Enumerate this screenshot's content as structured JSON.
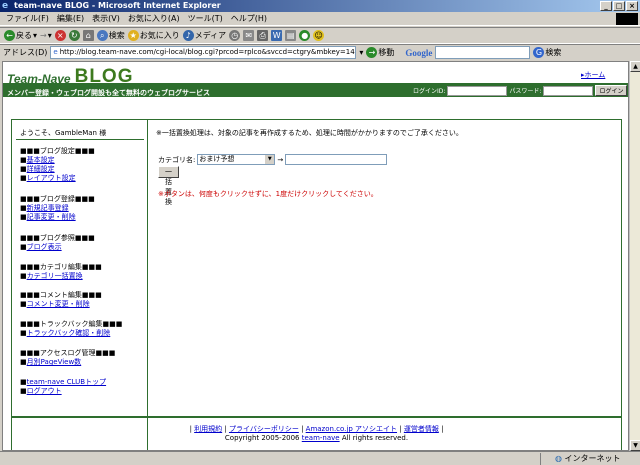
{
  "window": {
    "title": "team-nave BLOG - Microsoft Internet Explorer"
  },
  "menu": [
    "ファイル(F)",
    "編集(E)",
    "表示(V)",
    "お気に入り(A)",
    "ツール(T)",
    "ヘルプ(H)"
  ],
  "toolbar": {
    "back": "戻る",
    "search": "検索",
    "favorites": "お気に入り",
    "media": "メディア"
  },
  "address": {
    "label": "アドレス(D)",
    "url": "http://blog.team-nave.com/cgi-local/blog.cgi?prcod=rplco&svccd=ctgry&mbkey=146e6785",
    "go": "移動",
    "google_label": "Google",
    "google_search": "検索"
  },
  "header": {
    "logo_team": "Team-Nave",
    "logo_blog": "BLOG",
    "tagline": "メンバー登録・ウェブログ開設も全て無料のウェブログサービス",
    "home_link": "ホーム",
    "login_id_label": "ログインID:",
    "password_label": "パスワード:",
    "login_button": "ログイン"
  },
  "sidebar": {
    "welcome": "ようこそ、GambleMan 様",
    "sections": [
      {
        "head": "■■■ブログ設定■■■",
        "links": [
          "基本設定",
          "詳細設定",
          "レイアウト設定"
        ]
      },
      {
        "head": "■■■ブログ登録■■■",
        "links": [
          "新規記事登録",
          "記事変更・削除"
        ]
      },
      {
        "head": "■■■ブログ参照■■■",
        "links": [
          "ブログ表示"
        ]
      },
      {
        "head": "■■■カテゴリ編集■■■",
        "links": [
          "カテゴリ一括置換"
        ]
      },
      {
        "head": "■■■コメント編集■■■",
        "links": [
          "コメント変更・削除"
        ]
      },
      {
        "head": "■■■トラックバック編集■■■",
        "links": [
          "トラックバック確認・削除"
        ]
      },
      {
        "head": "■■■アクセスログ管理■■■",
        "links": [
          "月別PageView数"
        ]
      }
    ],
    "bottom_links": [
      "team-nave CLUBトップ",
      "ログアウト"
    ]
  },
  "main": {
    "notice": "※一括置換処理は、対象の記事を再作成するため、処理に時間がかかりますのでご了承ください。",
    "category_label": "カテゴリ名:",
    "category_selected": "おまけ予想",
    "arrow": "→",
    "replace_button": "一括置換",
    "warning": "※ボタンは、何度もクリックせずに、1度だけクリックしてください。"
  },
  "footer": {
    "links": [
      "利用規約",
      "プライバシーポリシー",
      "Amazon.co.jp アソシエイト",
      "運営者情報"
    ],
    "copyright_prefix": "Copyright 2005-2006",
    "copyright_link": "team-nave",
    "copyright_suffix": "All rights reserved."
  },
  "status": {
    "zone": "インターネット"
  },
  "colors": {
    "brand_green": "#2e6e2e",
    "warning_red": "#cc0000",
    "link_blue": "#0000cc"
  }
}
